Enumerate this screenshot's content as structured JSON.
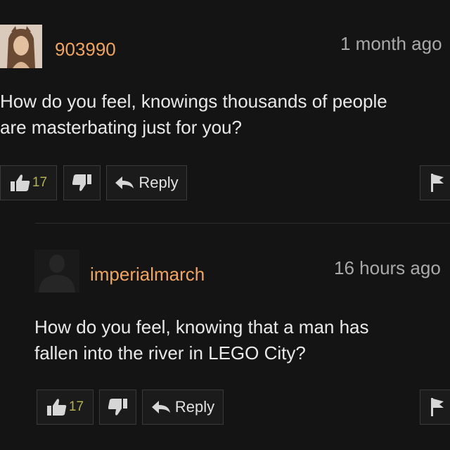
{
  "comments": [
    {
      "username": "903990",
      "timestamp": "1 month ago",
      "text_lines": [
        "How do you feel, knowings thousands of people",
        "are masterbating just for you?"
      ],
      "likes": "17",
      "reply_label": "Reply",
      "avatar_icon": "user-photo"
    },
    {
      "username": "imperialmarch",
      "timestamp": "16 hours ago",
      "text_lines": [
        "How do you feel, knowing that a man has",
        "fallen into the river in LEGO City?"
      ],
      "likes": "17",
      "reply_label": "Reply",
      "avatar_icon": "default-avatar-silhouette"
    }
  ],
  "icons": {
    "like": "thumbs-up-icon",
    "dislike": "thumbs-down-icon",
    "reply": "reply-arrow-icon",
    "flag": "flag-icon"
  },
  "colors": {
    "background": "#141414",
    "username": "#f0a45c",
    "like_count": "#b3b24c"
  }
}
